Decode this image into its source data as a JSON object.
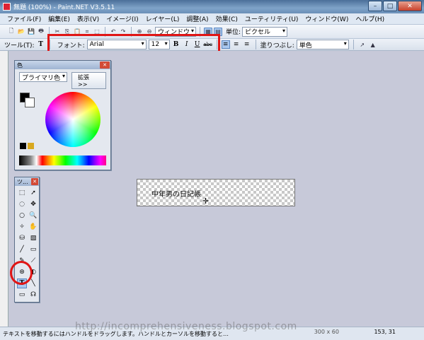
{
  "window": {
    "title": "無題 (100%) - Paint.NET V3.5.11",
    "minimize": "–",
    "maximize": "□",
    "close": "✕"
  },
  "menu": [
    "ファイル(F)",
    "編集(E)",
    "表示(V)",
    "イメージ(I)",
    "レイヤー(L)",
    "調整(A)",
    "効果(C)",
    "ユーティリティ(U)",
    "ウィンドウ(W)",
    "ヘルプ(H)"
  ],
  "toolbar1": {
    "window_combo": "ウィンドウ",
    "unit_label": "単位:",
    "unit_value": "ピクセル"
  },
  "toolbar2": {
    "tool_label": "ツール(T):",
    "font_label": "フォント:",
    "font_value": "Arial",
    "size_value": "12",
    "bold": "B",
    "italic": "I",
    "underline": "U",
    "strike": "abc",
    "fill_label": "塗りつぶし:",
    "fill_value": "単色"
  },
  "colors": {
    "panel_title": "色",
    "mode_value": "プライマリ色",
    "expand_button": "拡張 >>",
    "primary": "#000000",
    "secondary": "#ffffff",
    "accent": "#e01515"
  },
  "tools": {
    "panel_title": "ツ...",
    "text_tool": "T"
  },
  "canvas": {
    "text": "中年男の日記帳"
  },
  "status": {
    "hint": "テキストを移動するにはハンドルをドラッグします。ハンドルとカーソルを移動すると…",
    "watermark": "http://incomprehensiveness.blogspot.com",
    "size": "300 x 60",
    "coords": "153, 31"
  }
}
